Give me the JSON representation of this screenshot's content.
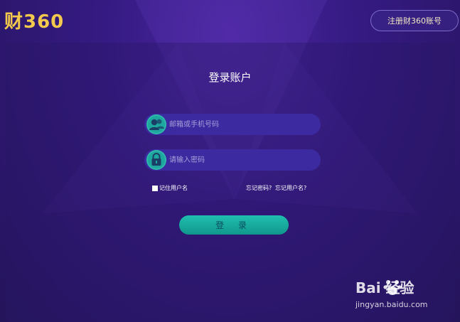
{
  "header": {
    "logo_text": "财360",
    "register_label": "注册财360账号"
  },
  "form": {
    "title": "登录账户",
    "account_placeholder": "邮箱或手机号码",
    "password_placeholder": "请输入密码",
    "remember_label": "记住用户名",
    "forgot_password_label": "忘记密码?",
    "forgot_username_label": "忘记用户名?",
    "login_label": "登 录"
  },
  "watermark": {
    "brand": "Bai  经验",
    "url": "jingyan.baidu.com"
  },
  "colors": {
    "accent": "#1ea79e",
    "logo": "#f2c94c",
    "background": "#351a82"
  }
}
